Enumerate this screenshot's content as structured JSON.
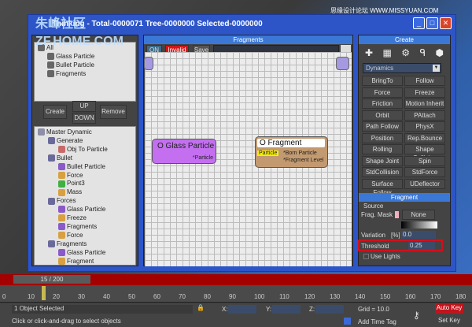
{
  "watermark": {
    "left": "朱峰社区 ZF.HOME.COM",
    "right": "思缘设计论坛 WWW.MISSYUAN.COM"
  },
  "window": {
    "title": "Thinking - Total-0000071  Tree-0000000  Selected-0000000",
    "min": "_",
    "max": "□",
    "close": "✕"
  },
  "groups": {
    "items": [
      "All",
      "Glass Particle",
      "Bullet Particle",
      "Fragments"
    ]
  },
  "group_buttons": {
    "create": "Create",
    "up": "UP",
    "down": "DOWN",
    "remove": "Remove"
  },
  "tree": [
    {
      "label": "Master Dynamic",
      "level": 0,
      "icon": "master"
    },
    {
      "label": "Generate",
      "level": 1,
      "icon": "folder"
    },
    {
      "label": "Obj To Particle",
      "level": 2,
      "icon": "gear-red"
    },
    {
      "label": "Bullet",
      "level": 1,
      "icon": "folder"
    },
    {
      "label": "Bullet Particle",
      "level": 2,
      "icon": "gear-purple"
    },
    {
      "label": "Force",
      "level": 2,
      "icon": "gear-orange"
    },
    {
      "label": "Point3",
      "level": 2,
      "icon": "gear-green"
    },
    {
      "label": "Mass",
      "level": 2,
      "icon": "gear-orange"
    },
    {
      "label": "Forces",
      "level": 1,
      "icon": "folder"
    },
    {
      "label": "Glass Particle",
      "level": 2,
      "icon": "gear-purple"
    },
    {
      "label": "Freeze",
      "level": 2,
      "icon": "gear-orange"
    },
    {
      "label": "Fragments",
      "level": 2,
      "icon": "gear-purple"
    },
    {
      "label": "Force",
      "level": 2,
      "icon": "gear-orange"
    },
    {
      "label": "Fragments",
      "level": 1,
      "icon": "folder"
    },
    {
      "label": "Glass Particle",
      "level": 2,
      "icon": "gear-purple"
    },
    {
      "label": "Fragment",
      "level": 2,
      "icon": "gear-orange"
    }
  ],
  "editor": {
    "title": "Fragments",
    "on": "ON",
    "invalid": "Invalid",
    "save": "Save",
    "node_glass": {
      "title": "O Glass Particle",
      "port": "*Particle"
    },
    "node_fragment": {
      "title": "O Fragment",
      "input": "Particle",
      "out1": "*Born Particle",
      "out2": "*Fragment Level"
    }
  },
  "create": {
    "title": "Create",
    "dropdown": "Dynamics",
    "buttons": [
      "BringTo",
      "Follow",
      "Force",
      "Freeze",
      "Friction",
      "Motion Inherit",
      "Orbit",
      "PAttach",
      "Path Follow",
      "PhysX",
      "Position Follow",
      "Rep.Bounce",
      "Rolling",
      "Shape Collision",
      "Shape Joint",
      "Spin",
      "StdCollision",
      "StdForce",
      "Surface Follow",
      "UDeflector"
    ]
  },
  "fragment": {
    "title": "Fragment",
    "source": "Source",
    "frag_mask": "Frag. Mask",
    "none": "None",
    "variation": "Variation",
    "variation_unit": "[%]",
    "variation_value": "0.0",
    "threshold": "Threshold",
    "threshold_value": "0.25",
    "use_lights": "Use Lights"
  },
  "timeline": {
    "frame": "15 / 200",
    "current": 15,
    "max": 200,
    "ticks": [
      "0",
      "10",
      "20",
      "30",
      "40",
      "50",
      "60",
      "70",
      "80",
      "90",
      "100",
      "110",
      "120",
      "130",
      "140",
      "150",
      "160",
      "170",
      "180"
    ]
  },
  "status": {
    "selected": "1 Object Selected",
    "prompt": "Click or click-and-drag to select objects",
    "x_label": "X:",
    "y_label": "Y:",
    "z_label": "Z:",
    "grid": "Grid = 10.0",
    "add_time_tag": "Add Time Tag",
    "auto_key": "Auto Key",
    "set_key": "Set Key",
    "auto_key_color": "#c0141c"
  }
}
